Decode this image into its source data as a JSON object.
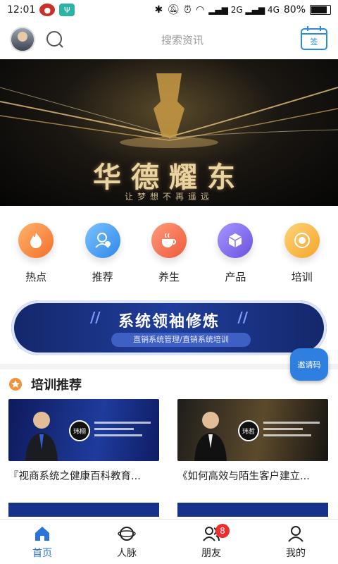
{
  "status_bar": {
    "time": "12:01",
    "network": "ᴺ2G ᴺ4G",
    "battery": "80%"
  },
  "header": {
    "search_placeholder": "搜索资讯",
    "calendar_label": "签"
  },
  "banner": {
    "title": "华德耀东",
    "subtitle": "让梦想不再遥远"
  },
  "categories": [
    {
      "label": "热点",
      "icon": "fire-icon",
      "color": "#f7853a"
    },
    {
      "label": "推荐",
      "icon": "recommend-user-icon",
      "color": "#3e9bf2"
    },
    {
      "label": "养生",
      "icon": "tea-cup-icon",
      "color": "#f26a4a"
    },
    {
      "label": "产品",
      "icon": "cube-icon",
      "color": "#7a64ea"
    },
    {
      "label": "培训",
      "icon": "target-icon",
      "color": "#f5b73a"
    }
  ],
  "promo": {
    "title": "系统领袖修炼",
    "subtitle": "直销系统管理/直销系统培训",
    "invite_label": "邀请码"
  },
  "training": {
    "section_title": "培训推荐",
    "cards": [
      {
        "title": "『视商系统之健康百科教育...",
        "badge": "玮栩"
      },
      {
        "title": "《如何高效与陌生客户建立...",
        "badge": "玮哲"
      }
    ]
  },
  "tab_bar": {
    "items": [
      {
        "label": "首页",
        "icon": "home-icon",
        "active": true
      },
      {
        "label": "人脉",
        "icon": "network-icon",
        "active": false
      },
      {
        "label": "朋友",
        "icon": "friends-icon",
        "active": false,
        "badge": "8"
      },
      {
        "label": "我的",
        "icon": "profile-icon",
        "active": false
      }
    ]
  },
  "colors": {
    "accent": "#2a73d9",
    "badge_red": "#f02d2d"
  }
}
